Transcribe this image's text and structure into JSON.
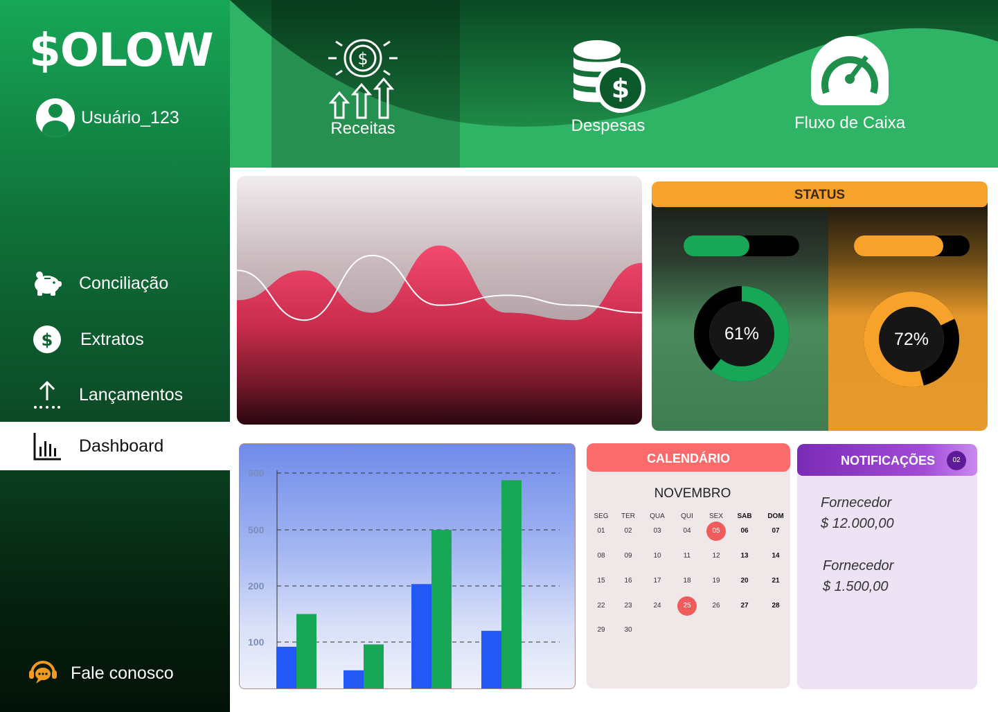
{
  "app": {
    "logo": "$OLOW"
  },
  "user": {
    "name": "Usuário_123"
  },
  "sidebar": {
    "items": [
      {
        "label": "Conciliação",
        "icon": "piggy-bank-icon"
      },
      {
        "label": "Extratos",
        "icon": "dollar-circle-icon"
      },
      {
        "label": "Lançamentos",
        "icon": "upload-arrow-icon"
      },
      {
        "label": "Dashboard",
        "icon": "bar-chart-icon",
        "active": true
      }
    ],
    "contact": {
      "label": "Fale conosco",
      "icon": "support-chat-icon"
    }
  },
  "header": {
    "items": [
      {
        "label": "Receitas",
        "icon": "revenue-growth-icon",
        "active": true
      },
      {
        "label": "Despesas",
        "icon": "coins-dollar-icon"
      },
      {
        "label": "Fluxo de Caixa",
        "icon": "gauge-icon"
      }
    ]
  },
  "status": {
    "title": "STATUS",
    "left": {
      "progress": 0.57,
      "percent_label": "61%",
      "percent": 0.61,
      "color": "#17a757"
    },
    "right": {
      "progress": 0.77,
      "percent_label": "72%",
      "percent": 0.72,
      "color": "#f7a22b"
    }
  },
  "calendar": {
    "title": "CALENDÁRIO",
    "month": "NOVEMBRO",
    "weekdays": [
      "SEG",
      "TER",
      "QUA",
      "QUI",
      "SEX",
      "SAB",
      "DOM"
    ],
    "weeks": [
      [
        "01",
        "02",
        "03",
        "04",
        "05",
        "06",
        "07"
      ],
      [
        "08",
        "09",
        "10",
        "11",
        "12",
        "13",
        "14"
      ],
      [
        "15",
        "16",
        "17",
        "18",
        "19",
        "20",
        "21"
      ],
      [
        "22",
        "23",
        "24",
        "25",
        "26",
        "27",
        "28"
      ],
      [
        "29",
        "30",
        "",
        "",
        "",
        "",
        ""
      ]
    ],
    "highlighted": [
      "05",
      "25"
    ]
  },
  "notifications": {
    "title": "NOTIFICAÇÕES",
    "count": "02",
    "items": [
      {
        "label": "Fornecedor",
        "value": "$ 12.000,00"
      },
      {
        "label": "Fornecedor",
        "value": "$ 1.500,00"
      }
    ]
  },
  "chart_data": [
    {
      "type": "bar",
      "categories": [
        "",
        "",
        "",
        ""
      ],
      "series": [
        {
          "values": [
            90,
            40,
            210,
            120
          ],
          "color": "#2458f5"
        },
        {
          "values": [
            150,
            95,
            500,
            850
          ],
          "color": "#17a757"
        }
      ],
      "yticks": [
        "100",
        "200",
        "500",
        "900"
      ],
      "ylim": [
        0,
        900
      ],
      "grid": true
    },
    {
      "type": "area",
      "series": [
        {
          "color": "#e8365e",
          "values": [
            0.5,
            0.62,
            0.45,
            0.72,
            0.45,
            0.42,
            0.65
          ]
        },
        {
          "color": "#ffffff",
          "values": [
            0.62,
            0.42,
            0.68,
            0.48,
            0.52,
            0.48,
            0.45
          ]
        }
      ],
      "grid": false
    }
  ]
}
